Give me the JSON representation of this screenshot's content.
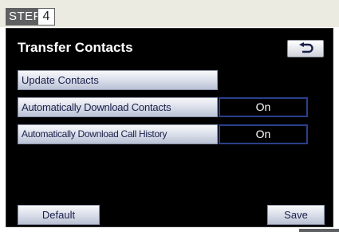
{
  "step": {
    "label": "STEP",
    "number": "4"
  },
  "screen": {
    "title": "Transfer Contacts",
    "back_icon": "return-arrow-icon",
    "buttons": {
      "update_contacts": "Update Contacts",
      "auto_download_contacts": "Automatically Download Contacts",
      "auto_download_call_history": "Automatically Download Call History",
      "default": "Default",
      "save": "Save"
    },
    "toggles": {
      "auto_download_contacts": "On",
      "auto_download_call_history": "On"
    }
  },
  "colors": {
    "screen_bg": "#000000",
    "button_text": "#1a1f4a",
    "toggle_border": "#2a3f8c",
    "step_label_bg": "#5f6062"
  }
}
